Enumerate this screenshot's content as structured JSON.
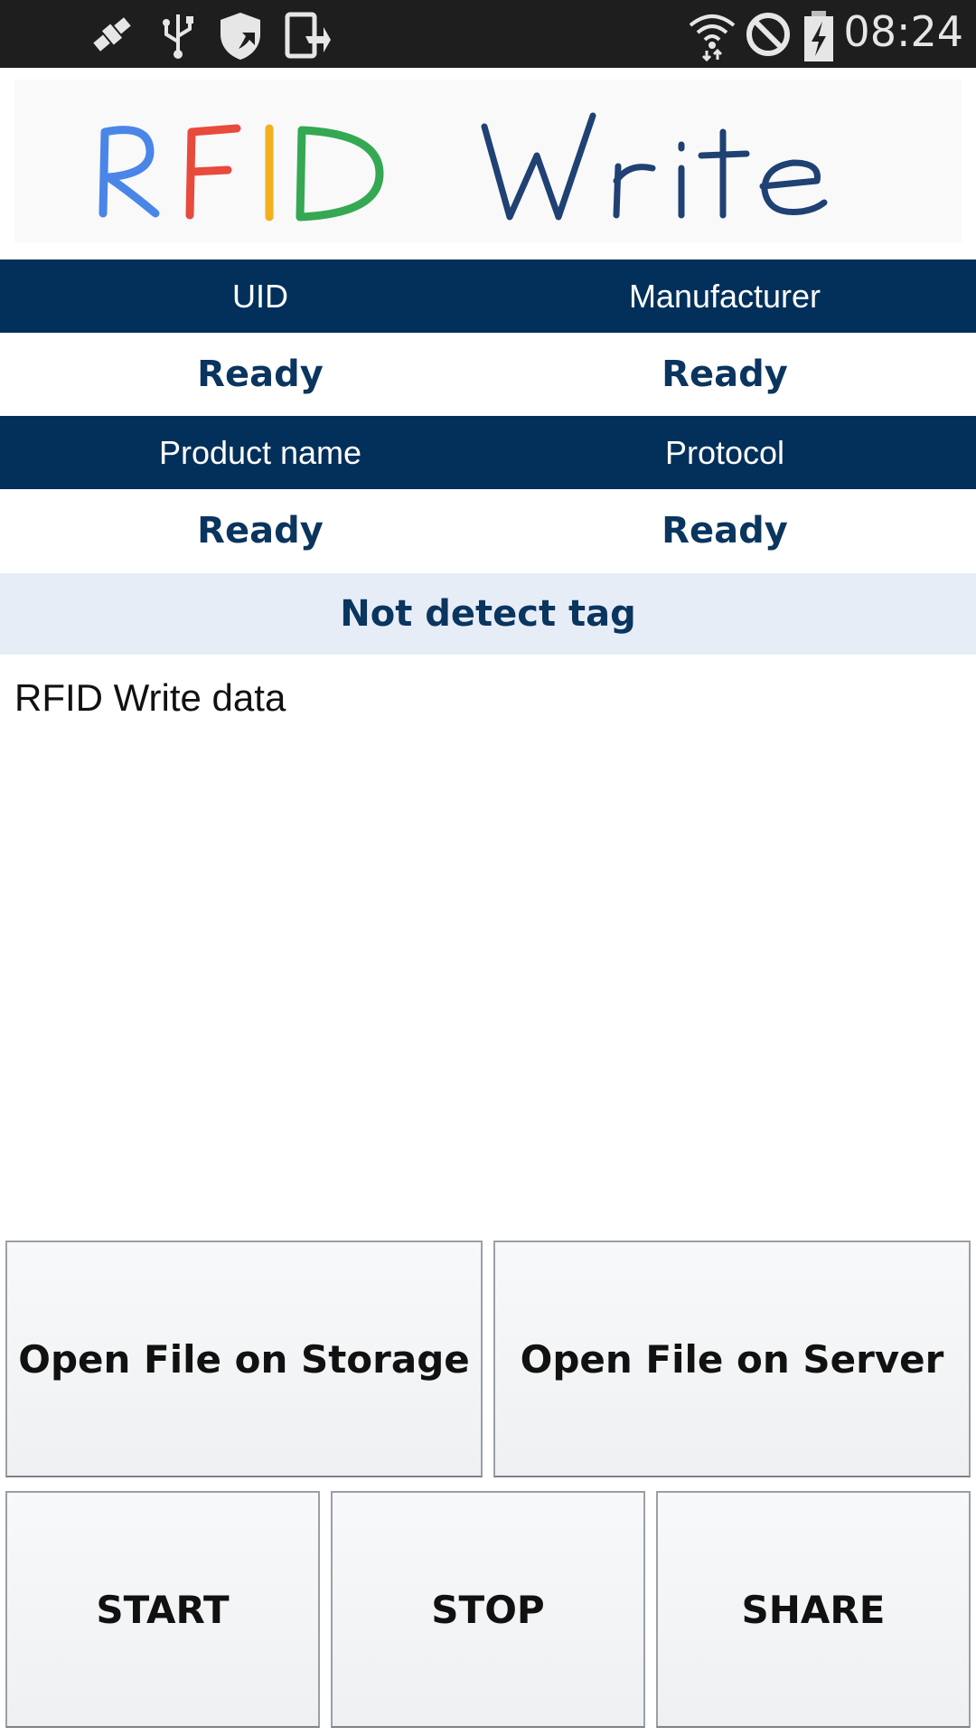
{
  "status_bar": {
    "time": "08:24",
    "left_icons": [
      "satellite-icon",
      "usb-icon",
      "shield-icon",
      "phone-upload-icon"
    ],
    "right_icons": [
      "wifi-icon",
      "blocked-icon",
      "battery-charging-icon"
    ]
  },
  "logo": {
    "word1_letters": [
      "R",
      "F",
      "I",
      "D"
    ],
    "word1_colors": [
      "#4a86e8",
      "#e84a3c",
      "#f2b01e",
      "#34a853"
    ],
    "word2": "Write",
    "word2_color": "#1f4173"
  },
  "info": {
    "headers": [
      "UID",
      "Manufacturer",
      "Product name",
      "Protocol"
    ],
    "values": [
      "Ready",
      "Ready",
      "Ready",
      "Ready"
    ],
    "status": "Not detect tag"
  },
  "data_area": {
    "text": "RFID Write data"
  },
  "buttons": {
    "open_storage": "Open File on Storage",
    "open_server": "Open File on Server",
    "start": "START",
    "stop": "STOP",
    "share": "SHARE"
  },
  "colors": {
    "header_bg": "#03305a",
    "value_text": "#0a355f",
    "status_bg": "#e7edf7"
  }
}
